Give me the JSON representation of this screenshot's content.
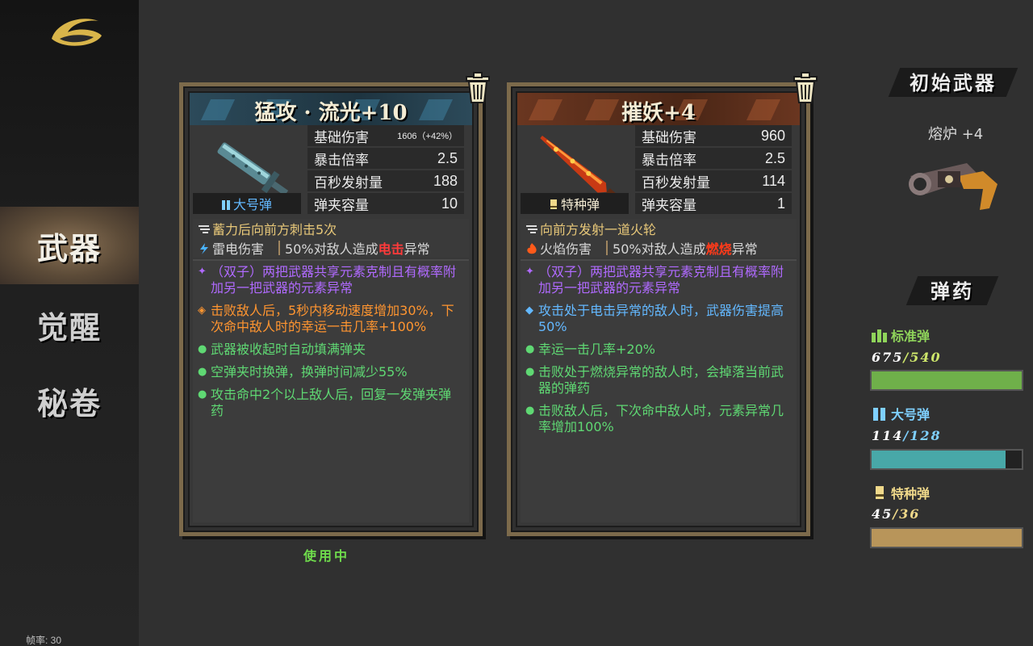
{
  "sidebar": {
    "nav": [
      {
        "label": "武器",
        "active": true
      },
      {
        "label": "觉醒",
        "active": false
      },
      {
        "label": "秘卷",
        "active": false
      }
    ],
    "fps_label": "帧率: 30"
  },
  "weapons": [
    {
      "title": "猛攻 · 流光+10",
      "banner_color": "#2c4a5a",
      "stats": [
        {
          "label": "基础伤害",
          "value": "1606（+42%）"
        },
        {
          "label": "暴击倍率",
          "value": "2.5"
        },
        {
          "label": "百秒发射量",
          "value": "188"
        },
        {
          "label": "弹夹容量",
          "value": "10"
        }
      ],
      "ammo_type": "大号弹",
      "ammo_icon": "blue-bullets-icon",
      "skill": "蓄力后向前方刺击5次",
      "element_damage": "雷电伤害",
      "element_effect_prefix": "50%对敌人造成",
      "element_effect_highlight": "电击",
      "element_effect_suffix": "异常",
      "affixes": [
        {
          "bullet": "✦",
          "color": "purple",
          "text": "（双子）两把武器共享元素克制且有概率附加另一把武器的元素异常"
        },
        {
          "bullet": "◈",
          "color": "orange",
          "text": "击败敌人后，5秒内移动速度增加30%，下次命中敌人时的幸运一击几率+100%"
        },
        {
          "bullet": "●",
          "color": "green",
          "text": "武器被收起时自动填满弹夹"
        },
        {
          "bullet": "●",
          "color": "green",
          "text": "空弹夹时换弹，换弹时间减少55%"
        },
        {
          "bullet": "●",
          "color": "green",
          "text": "攻击命中2个以上敌人后，回复一发弹夹弹药"
        }
      ],
      "status": "使用中"
    },
    {
      "title": "摧妖+4",
      "banner_color": "#6a3620",
      "stats": [
        {
          "label": "基础伤害",
          "value": "960"
        },
        {
          "label": "暴击倍率",
          "value": "2.5"
        },
        {
          "label": "百秒发射量",
          "value": "114"
        },
        {
          "label": "弹夹容量",
          "value": "1"
        }
      ],
      "ammo_type": "特种弹",
      "ammo_icon": "gold-shell-icon",
      "skill": "向前方发射一道火轮",
      "element_damage": "火焰伤害",
      "element_effect_prefix": "50%对敌人造成",
      "element_effect_highlight": "燃烧",
      "element_effect_suffix": "异常",
      "affixes": [
        {
          "bullet": "✦",
          "color": "purple",
          "text": "（双子）两把武器共享元素克制且有概率附加另一把武器的元素异常"
        },
        {
          "bullet": "◆",
          "color": "blue",
          "text": "攻击处于电击异常的敌人时，武器伤害提高50%"
        },
        {
          "bullet": "●",
          "color": "green",
          "text": "幸运一击几率+20%"
        },
        {
          "bullet": "●",
          "color": "green",
          "text": "击败处于燃烧异常的敌人时，会掉落当前武器的弹药"
        },
        {
          "bullet": "●",
          "color": "green",
          "text": "击败敌人后，下次命中敌人时，元素异常几率增加100%"
        }
      ]
    }
  ],
  "initial_weapon": {
    "header": "初始武器",
    "name": "熔炉 +4"
  },
  "ammo": {
    "header": "弹药",
    "types": [
      {
        "label": "标准弹",
        "current": "675",
        "max": "540",
        "fill": 1.0,
        "color": "#6fb04a",
        "label_color": "#8fd45a",
        "count_color": "#ffffff",
        "max_color": "#cde66b"
      },
      {
        "label": "大号弹",
        "current": "114",
        "max": "128",
        "fill": 0.89,
        "color": "#48a8a8",
        "label_color": "#7fd0ff",
        "count_color": "#ffffff",
        "max_color": "#7fd0ff"
      },
      {
        "label": "特种弹",
        "current": "45",
        "max": "36",
        "fill": 1.0,
        "color": "#b8955a",
        "label_color": "#f0d98a",
        "count_color": "#ffffff",
        "max_color": "#f0d98a"
      }
    ]
  }
}
